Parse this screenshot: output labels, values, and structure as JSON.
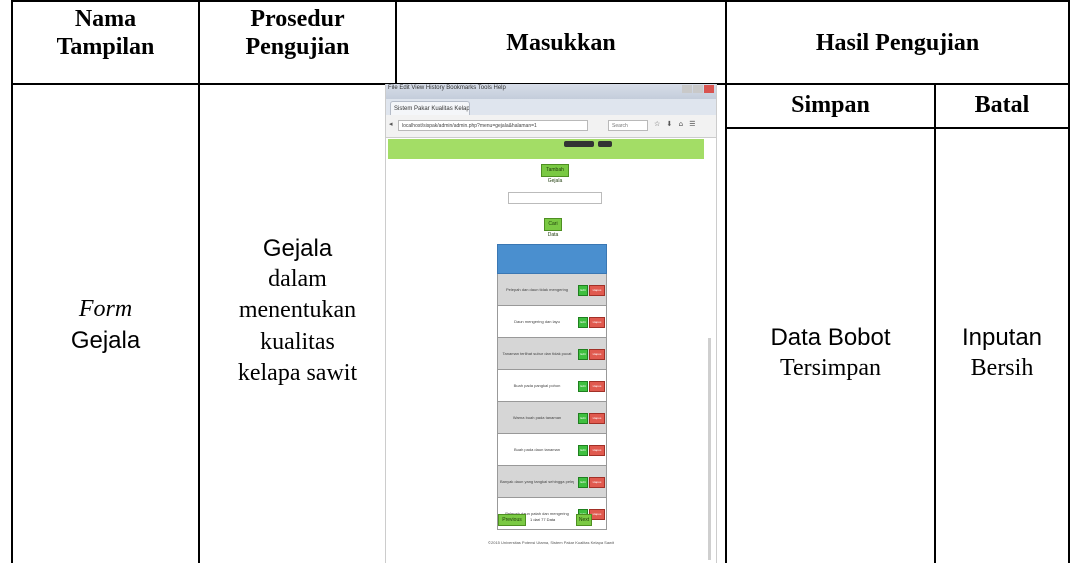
{
  "table": {
    "headers": {
      "nama_tampilan": [
        "Nama",
        "Tampilan"
      ],
      "prosedur_pengujian": [
        "Prosedur",
        "Pengujian"
      ],
      "masukkan": "Masukkan",
      "hasil_pengujian": "Hasil Pengujian",
      "simpan": "Simpan",
      "batal": "Batal"
    },
    "row": {
      "nama_tampilan": {
        "italic": "Form",
        "text": "Gejala"
      },
      "prosedur_pengujian": [
        "Gejala",
        "dalam",
        "menentukan",
        "kualitas",
        "kelapa sawit"
      ],
      "simpan_result": [
        "Data Bobot",
        "Tersimpan"
      ],
      "batal_result": [
        "Inputan",
        "Bersih"
      ]
    }
  },
  "screenshot": {
    "menu_text": "File  Edit  View  History  Bookmarks  Tools  Help",
    "tab_title": "Sistem Pakar Kualitas Kelapa Sa...  ×",
    "url": "localhost/sispak/admin/admin.php?menu=gejala&halaman=1",
    "search_placeholder": "Search",
    "toolbar_icons": "☆ ⬇ ⌂ ☰",
    "tambah_button": "Tambah Gejala",
    "cari_button": "Cari Data",
    "rows": [
      "Pelepah dan daun tidak mengering",
      "Daun mengering dan layu",
      "Tanaman terlihat subur dan tidak pucat",
      "Buah pada pangkal pohon",
      "Warna buah pada tanaman",
      "Buah pada daun tanaman",
      "Banyak daun yang tangkai sehingga pelepah",
      "Pelepah daun patah dan mengering"
    ],
    "edit_label": "Edit",
    "hapus_label": "Hapus",
    "pager_prev": "Previous",
    "pager_info": "1 dari 77 Data",
    "pager_next": "Next",
    "footer": "©2015 Universitas Potensi Utama, Sistem Pakar Kualitas Kelapa Sawit"
  }
}
